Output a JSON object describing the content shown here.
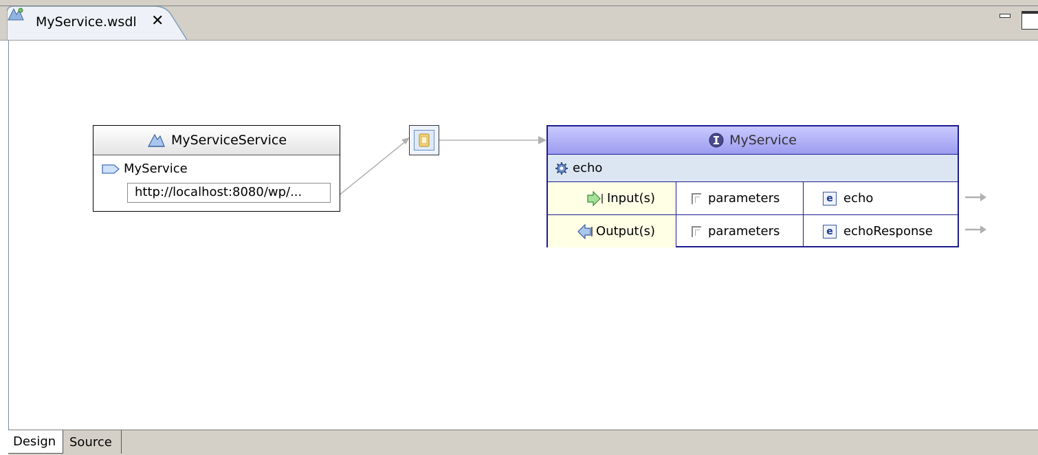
{
  "editor": {
    "tab_title": "MyService.wsdl",
    "close_glyph": "✕",
    "tab_icon": "wsdl-file-icon"
  },
  "service": {
    "name": "MyServiceService",
    "icon": "service-icon",
    "port": {
      "name": "MyService",
      "icon": "port-icon",
      "address": "http://localhost:8080/wp/..."
    }
  },
  "binding": {
    "icon": "binding-icon"
  },
  "port_type": {
    "name": "MyService",
    "icon": "interface-icon",
    "operation": {
      "name": "echo",
      "icon": "operation-gear-icon"
    },
    "rows": [
      {
        "label": "Input(s)",
        "part": "parameters",
        "element": "echo",
        "icon": "input-arrow-icon"
      },
      {
        "label": "Output(s)",
        "part": "parameters",
        "element": "echoResponse",
        "icon": "output-arrow-icon"
      }
    ]
  },
  "bottom_tabs": {
    "design": "Design",
    "source": "Source",
    "active": "Design"
  },
  "colors": {
    "port_type_border": "#1b1b8f",
    "port_type_header": "#b4b4fa",
    "operation_row": "#dce6f2",
    "io_label_bg": "#ffffe6"
  }
}
